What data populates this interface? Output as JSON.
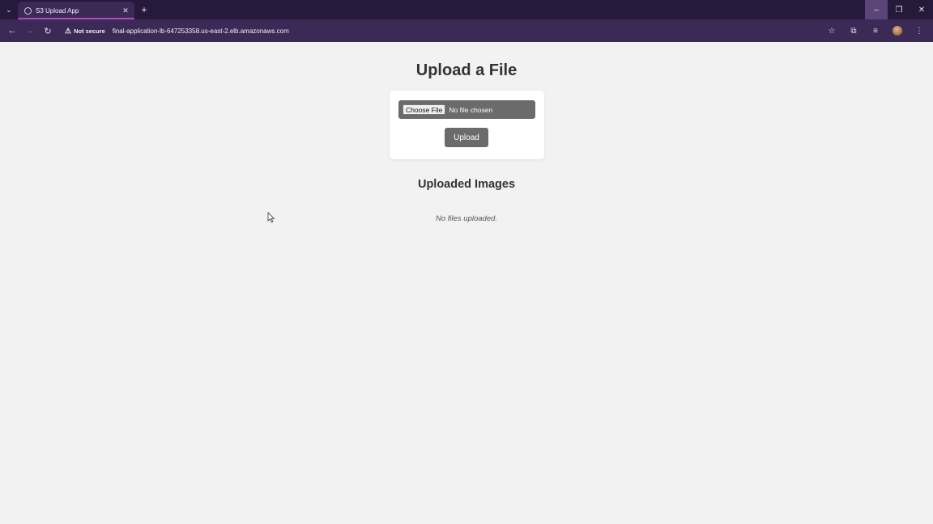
{
  "browser": {
    "tab": {
      "title": "S3 Upload App"
    },
    "new_tab_glyph": "+",
    "close_tab_glyph": "✕",
    "security_label": "Not secure",
    "url": "final-application-lb-647253358.us-east-2.elb.amazonaws.com",
    "icons": [
      "tab-search-icon",
      "globe-icon",
      "back-icon",
      "forward-icon",
      "reload-icon",
      "warning-icon",
      "star-icon",
      "extensions-icon",
      "reading-list-icon",
      "profile-avatar",
      "menu-icon",
      "minimize-icon",
      "restore-icon",
      "close-icon"
    ],
    "accent_color": "#b04bbd",
    "frame_color": "#26193a"
  },
  "page": {
    "heading": "Upload a File",
    "file_input": {
      "button_label": "Choose File",
      "status": "No file chosen"
    },
    "upload_button": "Upload",
    "uploaded_heading": "Uploaded Images",
    "empty_message": "No files uploaded."
  }
}
